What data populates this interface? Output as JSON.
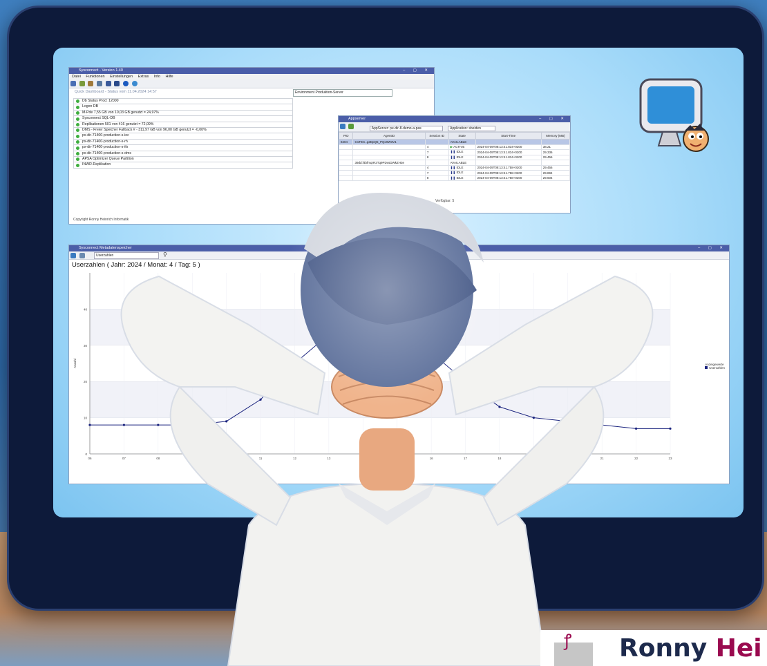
{
  "window_main": {
    "title": "Sysconnect - Version 1.40",
    "menu": [
      "Datei",
      "Funktionen",
      "Einstellungen",
      "Extras",
      "Info",
      "Hilfe"
    ],
    "environment_label": "Environment",
    "environment_value": "Produktion-Server",
    "dashboard_heading": "Quick Dashboard - Status vom 11.04.2024 14:57",
    "status_rows": [
      "Db Status Prod: 12000",
      "Logon DB",
      "M-Pde   7,55 GB von  10,03 GB genutzt =        24,97%",
      "Sysconnect SQL-DB",
      "Replikationen    501 von    416 genutzt =     72,09%",
      "DMS - Freier Speicher Fallback #  - 311,97 GB von   96,00 GB genutzt =       -0,00%",
      "px-dir-71400-production-s-ioc",
      "px-dir-71400-production-s-rh",
      "px-dir-71400-production-s-ifs",
      "px-dir-71400-production-s-dms",
      "APSA Optimizer Queue Partition",
      "INWR-Replikation"
    ],
    "copyright": "Copyright Ronny Heinrich Informatik"
  },
  "window_appserver": {
    "title": "Appserver",
    "appserver_field": "AppServer: pe-dir-8-demo-a-pas",
    "application_field": "Application: sbeiden",
    "columns": [
      "PID",
      "AgentID",
      "Session ID",
      "State",
      "Start-Time",
      "Memory (MB)"
    ],
    "rows": [
      [
        "8404",
        "C1T9m..g2DpQ5_PQo9W3V1",
        "",
        "AVAILABLE",
        "",
        ""
      ],
      [
        "",
        "",
        "4",
        "ACTIVE",
        "2024-04-09T08:13:41.834+0200",
        "38.21"
      ],
      [
        "",
        "",
        "7",
        "IDLE",
        "2024-04-09T08:13:41.834+0200",
        "29.336"
      ],
      [
        "",
        "",
        "8",
        "IDLE",
        "2024-04-09T08:13:41.834+0200",
        "29.456"
      ],
      [
        "",
        "39dd:f4bfmqrR2Tq9PDxsDWkZH3e",
        "",
        "AVAILABLE",
        "",
        ""
      ],
      [
        "",
        "",
        "4",
        "IDLE",
        "2024-04-09T08:13:41.758+0200",
        "29.456"
      ],
      [
        "",
        "",
        "7",
        "IDLE",
        "2024-04-09T08:13:41.758+0200",
        "29.894"
      ],
      [
        "",
        "",
        "8",
        "IDLE",
        "2024-04-09T08:13:41.758+0200",
        "29.604"
      ]
    ],
    "footer": "Verfügbar: 5"
  },
  "window_chart": {
    "title": "Sysconnect Metadatenspeicher",
    "dropdown_value": "Userzahlen",
    "heading": "Userzahlen ( Jahr: 2024 / Monat: 4 / Tag: 5 )"
  },
  "chart_data": {
    "type": "line",
    "title": "Userzahlen ( Jahr: 2024 / Monat: 4 / Tag: 5 )",
    "ylabel": "Anzahl",
    "xlabel": "",
    "ylim": [
      0,
      50
    ],
    "grid": true,
    "legend_placement": "right",
    "legend_title": "Anzeigewerte",
    "series": [
      {
        "name": "Userzahlen",
        "x": [
          "06",
          "07",
          "08",
          "09",
          "10",
          "11",
          "12",
          "13",
          "14",
          "15",
          "16",
          "17",
          "18",
          "19",
          "20",
          "21",
          "22",
          "23"
        ],
        "values": [
          8,
          8,
          8,
          8,
          9,
          15,
          25,
          33,
          35,
          34,
          28,
          20,
          13,
          10,
          9,
          8,
          7,
          7
        ]
      }
    ],
    "color": "#1a237e"
  },
  "branding": {
    "name_part1": "Ronny",
    "name_part2": "Hei",
    "accent_color": "#9a0a4f"
  }
}
